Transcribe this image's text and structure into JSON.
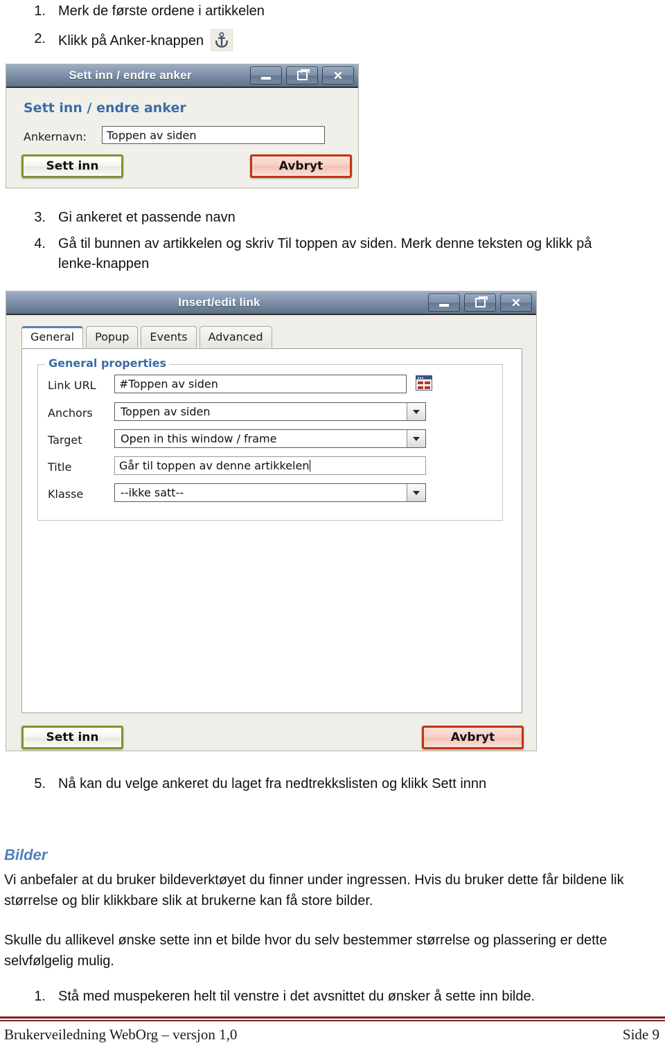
{
  "steps_top": [
    {
      "num": "1.",
      "text": "Merk de første ordene i artikkelen",
      "icon": null
    },
    {
      "num": "2.",
      "text": "Klikk på Anker-knappen",
      "icon": "anchor-icon"
    }
  ],
  "anchor_dialog": {
    "titlebar": {
      "title": "Sett inn / endre anker",
      "minimize_label": "minimize",
      "restore_label": "restore",
      "close_label": "close"
    },
    "heading": "Sett inn / endre anker",
    "field_label": "Ankernavn:",
    "field_value": "Toppen av siden",
    "insert_button": "Sett inn",
    "cancel_button": "Avbryt"
  },
  "steps_mid": [
    {
      "num": "3.",
      "text": "Gi ankeret et passende navn"
    },
    {
      "num": "4.",
      "text": "Gå til bunnen av artikkelen og skriv Til toppen av siden. Merk denne teksten og klikk på lenke-knappen"
    }
  ],
  "link_dialog": {
    "titlebar": {
      "title": "Insert/edit link",
      "minimize_label": "minimize",
      "restore_label": "restore",
      "close_label": "close"
    },
    "tabs": [
      {
        "label": "General",
        "active": true
      },
      {
        "label": "Popup",
        "active": false
      },
      {
        "label": "Events",
        "active": false
      },
      {
        "label": "Advanced",
        "active": false
      }
    ],
    "fieldset_legend": "General properties",
    "fields": {
      "link_url": {
        "label": "Link URL",
        "value": "#Toppen av siden",
        "browse_icon": "browse-files-icon"
      },
      "anchors": {
        "label": "Anchors",
        "value": "Toppen av siden"
      },
      "target": {
        "label": "Target",
        "value": "Open in this window / frame"
      },
      "title": {
        "label": "Title",
        "value": "Går til toppen av denne artikkelen"
      },
      "klasse": {
        "label": "Klasse",
        "value": "--ikke satt--"
      }
    },
    "insert_button": "Sett inn",
    "cancel_button": "Avbryt"
  },
  "steps_after": [
    {
      "num": "5.",
      "text": "Nå kan du velge ankeret du laget fra nedtrekkslisten og klikk Sett innn"
    }
  ],
  "bilder": {
    "heading": "Bilder",
    "paragraph1": "Vi anbefaler at du bruker bildeverktøyet du finner under ingressen. Hvis du bruker dette får bildene lik størrelse og blir klikkbare slik at brukerne kan få store bilder.",
    "paragraph2": "Skulle du allikevel ønske sette inn et bilde hvor du selv bestemmer størrelse og plassering er dette selvfølgelig mulig.",
    "steps": [
      {
        "num": "1.",
        "text": "Stå med muspekeren helt til venstre i det avsnittet du ønsker å sette inn bilde."
      }
    ]
  },
  "footer": {
    "left": "Brukerveiledning WebOrg – versjon 1,0",
    "right": "Side 9"
  },
  "colors": {
    "heading_blue": "#4f81bd",
    "dialog_heading_blue": "#3b6ca8",
    "footer_rule": "#7b1f1f",
    "insert_border": "#7f9431",
    "cancel_border": "#c1350f",
    "titlebar_blue": "#7e92aa"
  }
}
